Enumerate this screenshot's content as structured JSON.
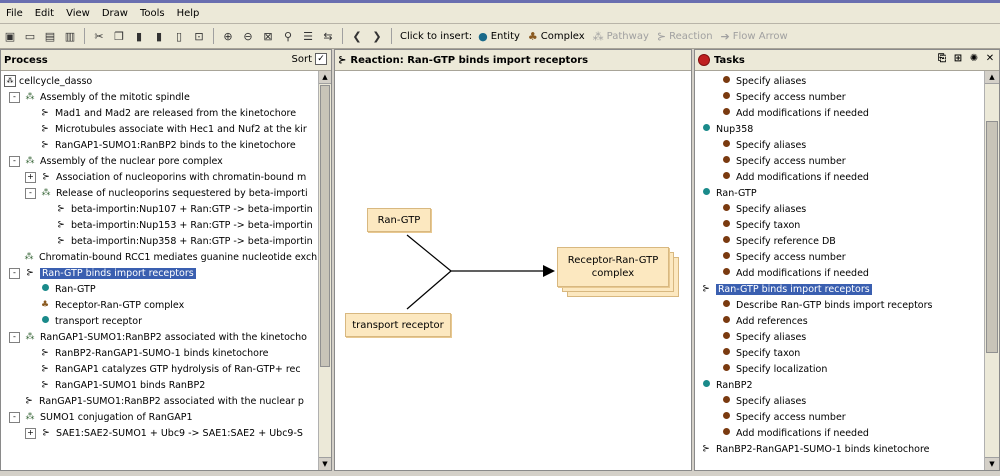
{
  "menu": [
    "File",
    "Edit",
    "View",
    "Draw",
    "Tools",
    "Help"
  ],
  "toolbar": {
    "insert_label": "Click to insert:",
    "inserts": [
      {
        "label": "Entity",
        "icon": "entity-icon",
        "enabled": true
      },
      {
        "label": "Complex",
        "icon": "complex-icon",
        "enabled": true
      },
      {
        "label": "Pathway",
        "icon": "pathway-icon",
        "enabled": false
      },
      {
        "label": "Reaction",
        "icon": "reaction-icon",
        "enabled": false
      },
      {
        "label": "Flow Arrow",
        "icon": "flow-arrow-icon",
        "enabled": false
      }
    ]
  },
  "process": {
    "title": "Process",
    "sort_label": "Sort",
    "root": "cellcycle_dasso",
    "items": [
      {
        "level": 0,
        "exp": "-",
        "icon": "pathway",
        "label": "Assembly of the mitotic spindle"
      },
      {
        "level": 1,
        "exp": "",
        "icon": "reaction",
        "label": "Mad1 and Mad2 are released from the kinetochore"
      },
      {
        "level": 1,
        "exp": "",
        "icon": "reaction",
        "label": "Microtubules associate with Hec1 and Nuf2 at the kir"
      },
      {
        "level": 1,
        "exp": "",
        "icon": "reaction",
        "label": "RanGAP1-SUMO1:RanBP2 binds to the kinetochore"
      },
      {
        "level": 0,
        "exp": "-",
        "icon": "pathway",
        "label": "Assembly of the nuclear pore complex"
      },
      {
        "level": 1,
        "exp": "+",
        "icon": "reaction",
        "label": "Association of nucleoporins with chromatin-bound m"
      },
      {
        "level": 1,
        "exp": "-",
        "icon": "pathway",
        "label": "Release of nucleoporins sequestered by beta-importi"
      },
      {
        "level": 2,
        "exp": "",
        "icon": "reaction",
        "label": "beta-importin:Nup107 + Ran:GTP -> beta-importin"
      },
      {
        "level": 2,
        "exp": "",
        "icon": "reaction",
        "label": "beta-importin:Nup153 + Ran:GTP -> beta-importin"
      },
      {
        "level": 2,
        "exp": "",
        "icon": "reaction",
        "label": "beta-importin:Nup358 + Ran:GTP -> beta-importin"
      },
      {
        "level": 0,
        "exp": "",
        "icon": "pathway",
        "label": "Chromatin-bound RCC1 mediates guanine nucleotide exch"
      },
      {
        "level": 0,
        "exp": "-",
        "icon": "reaction",
        "label": "Ran-GTP binds import receptors",
        "selected": true
      },
      {
        "level": 1,
        "exp": "",
        "icon": "entity",
        "label": "Ran-GTP"
      },
      {
        "level": 1,
        "exp": "",
        "icon": "complex",
        "label": "Receptor-Ran-GTP complex"
      },
      {
        "level": 1,
        "exp": "",
        "icon": "entity",
        "label": "transport receptor"
      },
      {
        "level": 0,
        "exp": "-",
        "icon": "pathway",
        "label": "RanGAP1-SUMO1:RanBP2 associated with the kinetocho"
      },
      {
        "level": 1,
        "exp": "",
        "icon": "reaction",
        "label": "RanBP2-RanGAP1-SUMO-1 binds kinetochore"
      },
      {
        "level": 1,
        "exp": "",
        "icon": "reaction",
        "label": "RanGAP1 catalyzes GTP hydrolysis of Ran-GTP+ rec"
      },
      {
        "level": 1,
        "exp": "",
        "icon": "reaction",
        "label": "RanGAP1-SUMO1 binds RanBP2"
      },
      {
        "level": 0,
        "exp": "",
        "icon": "reaction",
        "label": "RanGAP1-SUMO1:RanBP2 associated with the nuclear p"
      },
      {
        "level": 0,
        "exp": "-",
        "icon": "pathway",
        "label": "SUMO1 conjugation of RanGAP1"
      },
      {
        "level": 1,
        "exp": "+",
        "icon": "reaction",
        "label": "SAE1:SAE2-SUMO1 + Ubc9 -> SAE1:SAE2 + Ubc9-S"
      }
    ]
  },
  "reaction": {
    "title": "Reaction: Ran-GTP binds import receptors",
    "input1": "Ran-GTP",
    "input2": "transport receptor",
    "output": "Receptor-Ran-GTP complex"
  },
  "tasks": {
    "title": "Tasks",
    "items": [
      {
        "level": 1,
        "icon": "task",
        "label": "Specify aliases"
      },
      {
        "level": 1,
        "icon": "task",
        "label": "Specify access number"
      },
      {
        "level": 1,
        "icon": "task",
        "label": "Add modifications if needed"
      },
      {
        "level": 0,
        "icon": "entity",
        "label": "Nup358"
      },
      {
        "level": 1,
        "icon": "task",
        "label": "Specify aliases"
      },
      {
        "level": 1,
        "icon": "task",
        "label": "Specify access number"
      },
      {
        "level": 1,
        "icon": "task",
        "label": "Add modifications if needed"
      },
      {
        "level": 0,
        "icon": "entity",
        "label": "Ran-GTP"
      },
      {
        "level": 1,
        "icon": "task",
        "label": "Specify aliases"
      },
      {
        "level": 1,
        "icon": "task",
        "label": "Specify taxon"
      },
      {
        "level": 1,
        "icon": "task",
        "label": "Specify reference DB"
      },
      {
        "level": 1,
        "icon": "task",
        "label": "Specify access number"
      },
      {
        "level": 1,
        "icon": "task",
        "label": "Add modifications if needed"
      },
      {
        "level": 0,
        "icon": "reaction",
        "label": "Ran-GTP binds import receptors",
        "selected": true
      },
      {
        "level": 1,
        "icon": "task",
        "label": "Describe Ran-GTP binds import receptors"
      },
      {
        "level": 1,
        "icon": "task",
        "label": "Add references"
      },
      {
        "level": 1,
        "icon": "task",
        "label": "Specify aliases"
      },
      {
        "level": 1,
        "icon": "task",
        "label": "Specify taxon"
      },
      {
        "level": 1,
        "icon": "task",
        "label": "Specify localization"
      },
      {
        "level": 0,
        "icon": "entity",
        "label": "RanBP2"
      },
      {
        "level": 1,
        "icon": "task",
        "label": "Specify aliases"
      },
      {
        "level": 1,
        "icon": "task",
        "label": "Specify access number"
      },
      {
        "level": 1,
        "icon": "task",
        "label": "Add modifications if needed"
      },
      {
        "level": 0,
        "icon": "reaction",
        "label": "RanBP2-RanGAP1-SUMO-1 binds kinetochore"
      }
    ]
  }
}
